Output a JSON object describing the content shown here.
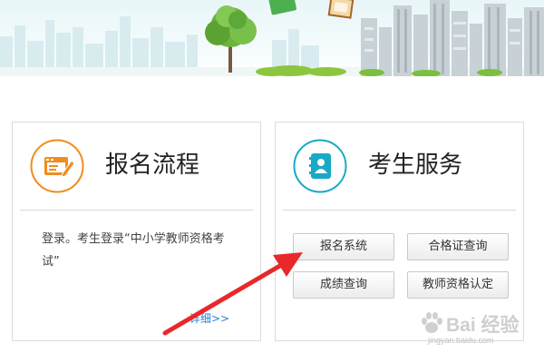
{
  "colors": {
    "accent_orange": "#f08c1e",
    "accent_teal": "#17a9c7",
    "link_blue": "#2a82d1",
    "arrow_red": "#e8282b"
  },
  "registration_process": {
    "title": "报名流程",
    "icon": "form-edit-icon",
    "description": "登录。考生登录“中小学教师资格考试”",
    "more_link": "详细>>"
  },
  "candidate_services": {
    "title": "考生服务",
    "icon": "contact-book-icon",
    "buttons": [
      {
        "label": "报名系统"
      },
      {
        "label": "合格证查询"
      },
      {
        "label": "成绩查询"
      },
      {
        "label": "教师资格认定"
      }
    ]
  },
  "watermark": {
    "brand": "Bai 经验",
    "url": "jingyan.baidu.com"
  }
}
